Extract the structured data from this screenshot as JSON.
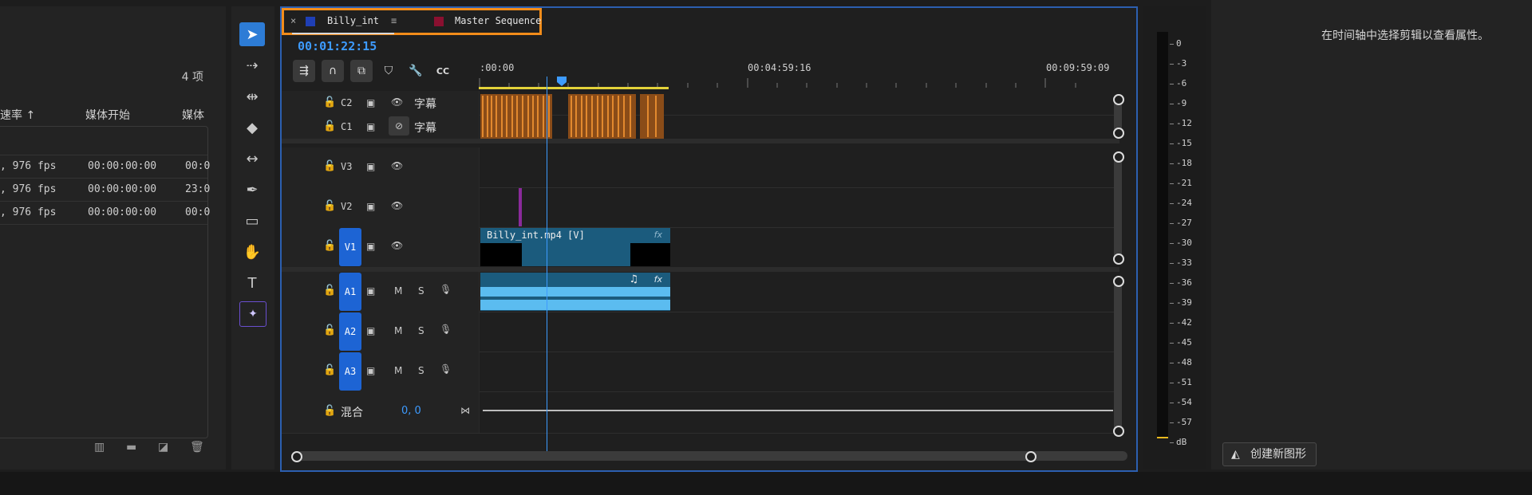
{
  "project": {
    "item_count": "4 项",
    "columns": [
      "速率 ↑",
      "媒体开始",
      "媒体"
    ],
    "rows": [
      {
        "rate": ", 976 fps",
        "start": "00:00:00:00",
        "media": "00:0"
      },
      {
        "rate": ", 976 fps",
        "start": "00:00:00:00",
        "media": "23:0"
      },
      {
        "rate": ", 976 fps",
        "start": "00:00:00:00",
        "media": "00:0"
      }
    ]
  },
  "timeline": {
    "tabs": [
      {
        "label": "Billy_int",
        "color": "#1f3fb5",
        "active": true
      },
      {
        "label": "Master Sequence",
        "color": "#8a1030",
        "active": false
      }
    ],
    "close_glyph": "×",
    "menu_glyph": "≡",
    "timecode": "00:01:22:15",
    "ruler_labels": [
      ":00:00",
      "00:04:59:16",
      "00:09:59:09"
    ],
    "tracks": {
      "c2": {
        "name": "C2",
        "type": "字幕"
      },
      "c1": {
        "name": "C1",
        "type": "字幕"
      },
      "v3": {
        "name": "V3"
      },
      "v2": {
        "name": "V2"
      },
      "v1": {
        "name": "V1"
      },
      "a1": {
        "name": "A1",
        "m": "M",
        "s": "S"
      },
      "a2": {
        "name": "A2",
        "m": "M",
        "s": "S"
      },
      "a3": {
        "name": "A3",
        "m": "M",
        "s": "S"
      },
      "mix": {
        "name": "混合",
        "value": "0, 0"
      }
    },
    "video_clip_label": "Billy_int.mp4 [V]",
    "fx_label": "fx",
    "music_glyph": "♫",
    "playhead_fraction": 0.0847
  },
  "meter": {
    "labels": [
      "0",
      "-3",
      "-6",
      "-9",
      "-12",
      "-15",
      "-18",
      "-21",
      "-24",
      "-27",
      "-30",
      "-33",
      "-36",
      "-39",
      "-42",
      "-45",
      "-48",
      "-51",
      "-54",
      "-57",
      "dB"
    ]
  },
  "properties": {
    "message": "在时间轴中选择剪辑以查看属性。",
    "new_graphic_label": "创建新图形"
  },
  "colors": {
    "accent": "#2d7cd6",
    "tab_highlight": "#f28c1a",
    "clip_video": "#1b5b7d",
    "clip_audio": "#5bbcf0",
    "caption": "#a0581c"
  }
}
